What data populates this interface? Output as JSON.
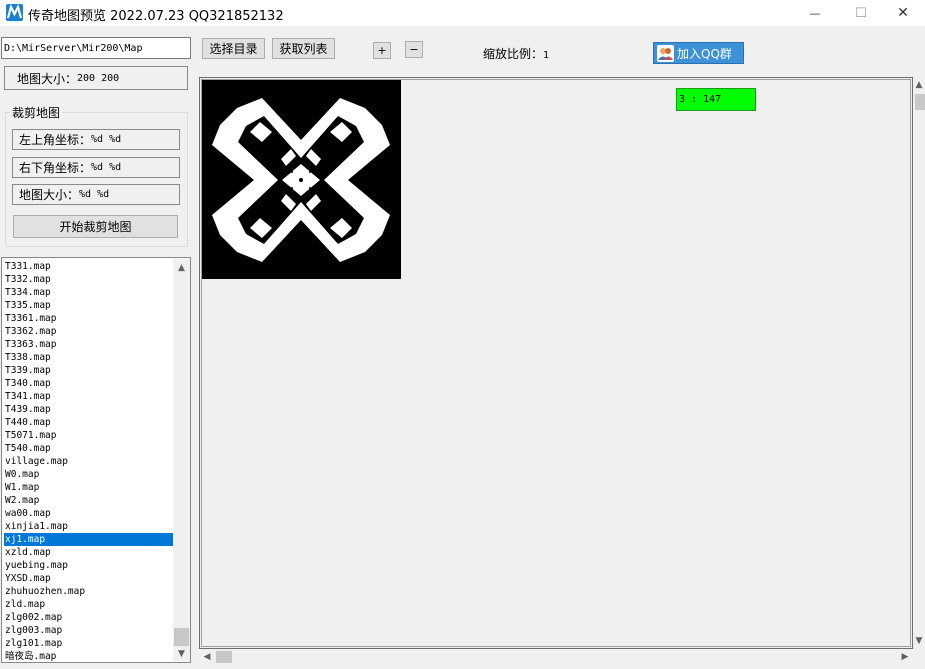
{
  "window": {
    "title": "传奇地图预览 2022.07.23 QQ321852132",
    "min_glyph": "—",
    "max_glyph": "☐",
    "close_glyph": "✕"
  },
  "toolbar": {
    "path_value": "D:\\MirServer\\Mir200\\Map",
    "select_dir_label": "选择目录",
    "get_list_label": "获取列表",
    "zoom_in_label": "+",
    "zoom_out_label": "−",
    "zoom_ratio_label": "缩放比例：",
    "zoom_ratio_value": "1",
    "qq_group_label": "加入QQ群"
  },
  "info": {
    "map_size_label": "地图大小：",
    "map_size_value": "200  200"
  },
  "crop": {
    "group_title": "裁剪地图",
    "top_left_label": "左上角坐标：",
    "top_left_value": "%d  %d",
    "bottom_right_label": "右下角坐标：",
    "bottom_right_value": "%d  %d",
    "size_label": "地图大小：",
    "size_value": "%d  %d",
    "start_button": "开始裁剪地图"
  },
  "file_list": {
    "selected_index": 21,
    "items": [
      "T331.map",
      "T332.map",
      "T334.map",
      "T335.map",
      "T3361.map",
      "T3362.map",
      "T3363.map",
      "T338.map",
      "T339.map",
      "T340.map",
      "T341.map",
      "T439.map",
      "T440.map",
      "T5071.map",
      "T540.map",
      "village.map",
      "W0.map",
      "W1.map",
      "W2.map",
      "wa00.map",
      "xinjia1.map",
      "xj1.map",
      "xzld.map",
      "yuebing.map",
      "YXSD.map",
      "zhuhuozhen.map",
      "zld.map",
      "zlg002.map",
      "zlg003.map",
      "zlg101.map",
      "暗夜岛.map"
    ]
  },
  "map_view": {
    "coord_readout": "3 : 147",
    "coord_badge_color": "#00ff00"
  },
  "colors": {
    "accent": "#0078d7",
    "qq_button": "#3d91d6"
  }
}
